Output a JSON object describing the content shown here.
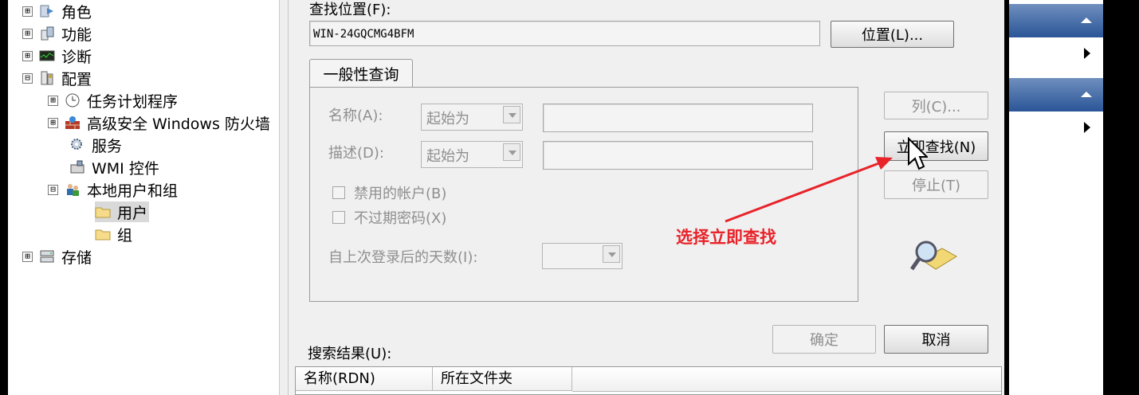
{
  "tree": {
    "items": [
      {
        "label": "角色",
        "expander": "⊞"
      },
      {
        "label": "功能",
        "expander": "⊞"
      },
      {
        "label": "诊断",
        "expander": "⊞"
      },
      {
        "label": "配置",
        "expander": "⊟"
      },
      {
        "label": "任务计划程序",
        "expander": "⊞"
      },
      {
        "label": "高级安全 Windows 防火墙",
        "expander": "⊞"
      },
      {
        "label": "服务",
        "expander": ""
      },
      {
        "label": "WMI 控件",
        "expander": ""
      },
      {
        "label": "本地用户和组",
        "expander": "⊟"
      },
      {
        "label": "用户",
        "expander": ""
      },
      {
        "label": "组",
        "expander": ""
      },
      {
        "label": "存储",
        "expander": "⊞"
      }
    ]
  },
  "dialog": {
    "location_label": "查找位置(F):",
    "location_value": "WIN-24GQCMG4BFM",
    "location_button": "位置(L)...",
    "tab_label": "一般性查询",
    "name_label": "名称(A):",
    "name_combo": "起始为",
    "desc_label": "描述(D):",
    "desc_combo": "起始为",
    "disabled_accounts": "禁用的帐户(B)",
    "non_expiring_pw": "不过期密码(X)",
    "days_label": "自上次登录后的天数(I):",
    "columns_button": "列(C)...",
    "find_now_button": "立即查找(N)",
    "stop_button": "停止(T)",
    "ok_button": "确定",
    "cancel_button": "取消",
    "results_label": "搜索结果(U):",
    "results_columns": [
      "名称(RDN)",
      "所在文件夹"
    ]
  },
  "annotation": {
    "text": "选择立即查找",
    "color": "#e8232a"
  }
}
